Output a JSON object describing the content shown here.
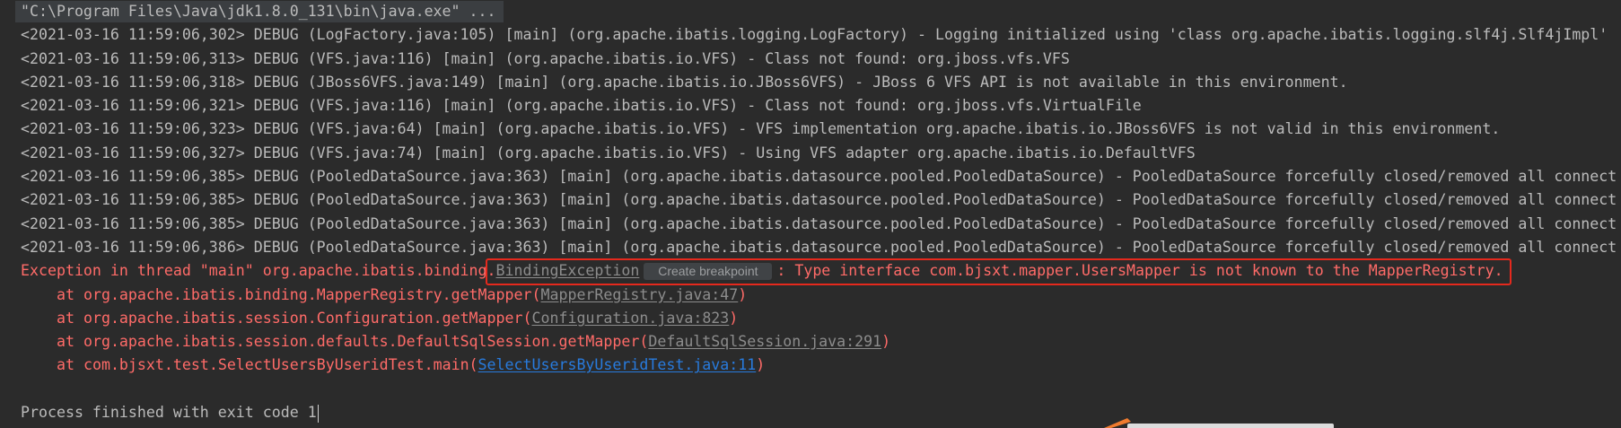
{
  "console": {
    "command_line": "\"C:\\Program Files\\Java\\jdk1.8.0_131\\bin\\java.exe\" ...",
    "log_lines": [
      "<2021-03-16 11:59:06,302> DEBUG (LogFactory.java:105) [main] (org.apache.ibatis.logging.LogFactory) - Logging initialized using 'class org.apache.ibatis.logging.slf4j.Slf4jImpl'",
      "<2021-03-16 11:59:06,313> DEBUG (VFS.java:116) [main] (org.apache.ibatis.io.VFS) - Class not found: org.jboss.vfs.VFS",
      "<2021-03-16 11:59:06,318> DEBUG (JBoss6VFS.java:149) [main] (org.apache.ibatis.io.JBoss6VFS) - JBoss 6 VFS API is not available in this environment.",
      "<2021-03-16 11:59:06,321> DEBUG (VFS.java:116) [main] (org.apache.ibatis.io.VFS) - Class not found: org.jboss.vfs.VirtualFile",
      "<2021-03-16 11:59:06,323> DEBUG (VFS.java:64) [main] (org.apache.ibatis.io.VFS) - VFS implementation org.apache.ibatis.io.JBoss6VFS is not valid in this environment.",
      "<2021-03-16 11:59:06,327> DEBUG (VFS.java:74) [main] (org.apache.ibatis.io.VFS) - Using VFS adapter org.apache.ibatis.io.DefaultVFS",
      "<2021-03-16 11:59:06,385> DEBUG (PooledDataSource.java:363) [main] (org.apache.ibatis.datasource.pooled.PooledDataSource) - PooledDataSource forcefully closed/removed all connect",
      "<2021-03-16 11:59:06,385> DEBUG (PooledDataSource.java:363) [main] (org.apache.ibatis.datasource.pooled.PooledDataSource) - PooledDataSource forcefully closed/removed all connect",
      "<2021-03-16 11:59:06,385> DEBUG (PooledDataSource.java:363) [main] (org.apache.ibatis.datasource.pooled.PooledDataSource) - PooledDataSource forcefully closed/removed all connect",
      "<2021-03-16 11:59:06,386> DEBUG (PooledDataSource.java:363) [main] (org.apache.ibatis.datasource.pooled.PooledDataSource) - PooledDataSource forcefully closed/removed all connect"
    ],
    "exception": {
      "prefix": "Exception in thread \"main\" org.apache.ibatis.binding.",
      "class_link": "BindingException",
      "hint": "Create breakpoint",
      "message": ": Type interface com.bjsxt.mapper.UsersMapper is not known to the MapperRegistry."
    },
    "stack_trace": [
      {
        "prefix": "at org.apache.ibatis.binding.MapperRegistry.getMapper(",
        "link": "MapperRegistry.java:47",
        "suffix": ")"
      },
      {
        "prefix": "at org.apache.ibatis.session.Configuration.getMapper(",
        "link": "Configuration.java:823",
        "suffix": ")"
      },
      {
        "prefix": "at org.apache.ibatis.session.defaults.DefaultSqlSession.getMapper(",
        "link": "DefaultSqlSession.java:291",
        "suffix": ")"
      },
      {
        "prefix": "at com.bjsxt.test.SelectUsersByUseridTest.main(",
        "link": "SelectUsersByUseridTest.java:11",
        "suffix": ")"
      }
    ],
    "exit_message": "Process finished with exit code 1"
  },
  "colors": {
    "background": "#2b2b2b",
    "text": "#bbbbbb",
    "error": "#ff6b68",
    "library_link": "#8c8c8c",
    "project_link": "#287bde",
    "highlight_box": "#e5291d",
    "annotation": "#f07b2e"
  }
}
